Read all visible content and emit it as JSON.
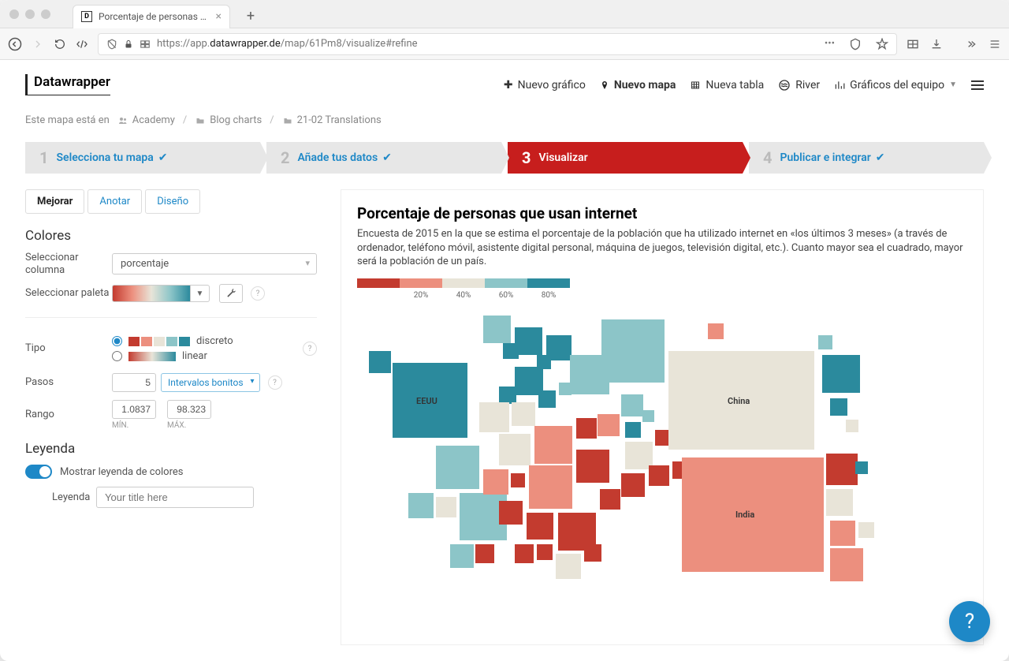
{
  "browser": {
    "tab_title": "Porcentaje de personas que us…",
    "url_left": "https://app.",
    "url_domain": "datawrapper.de",
    "url_path": "/map/61Pm8/visualize#refine"
  },
  "nav": {
    "brand": "Datawrapper",
    "new_chart": "Nuevo gráfico",
    "new_map": "Nuevo mapa",
    "new_table": "Nueva tabla",
    "river": "River",
    "team_charts": "Gráficos del equipo"
  },
  "breadcrumb": {
    "prefix": "Este mapa está en",
    "items": [
      "Academy",
      "Blog charts",
      "21-02 Translations"
    ]
  },
  "steps": {
    "s1": {
      "num": "1",
      "label": "Selecciona tu mapa"
    },
    "s2": {
      "num": "2",
      "label": "Añade tus datos"
    },
    "s3": {
      "num": "3",
      "label": "Visualizar"
    },
    "s4": {
      "num": "4",
      "label": "Publicar e integrar"
    }
  },
  "tabs": {
    "refine": "Mejorar",
    "annotate": "Anotar",
    "design": "Diseño"
  },
  "left": {
    "colores": "Colores",
    "select_column": "Seleccionar columna",
    "column_value": "porcentaje",
    "select_palette": "Seleccionar paleta",
    "tipo": "Tipo",
    "discreto": "discreto",
    "linear": "linear",
    "pasos": "Pasos",
    "pasos_value": "5",
    "intervalos": "Intervalos bonitos",
    "rango": "Rango",
    "min_value": "1.0837",
    "min_label": "MÍN.",
    "max_value": "98.323",
    "max_label": "MÁX.",
    "leyenda": "Leyenda",
    "show_legend": "Mostrar leyenda de colores",
    "leyenda_label": "Leyenda",
    "leyenda_placeholder": "Your title here"
  },
  "preview": {
    "title": "Porcentaje de personas que usan internet",
    "desc": "Encuesta de 2015 en la que se estima el porcentaje de la población que ha utilizado internet en «los últimos 3 meses» (a través de ordenador, teléfono móvil, asistente digital personal, máquina de juegos, televisión digital, etc.). Cuanto mayor sea el cuadrado, mayor será la población de un país.",
    "ticks": [
      "20%",
      "40%",
      "60%",
      "80%"
    ],
    "labels": {
      "eeuu": "EEUU",
      "china": "China",
      "india": "India"
    }
  },
  "colors": {
    "c1": "#c33b2f",
    "c2": "#ec8f7e",
    "c3": "#e8e4d8",
    "c4": "#8cc5c8",
    "c5": "#2b8a9d"
  }
}
